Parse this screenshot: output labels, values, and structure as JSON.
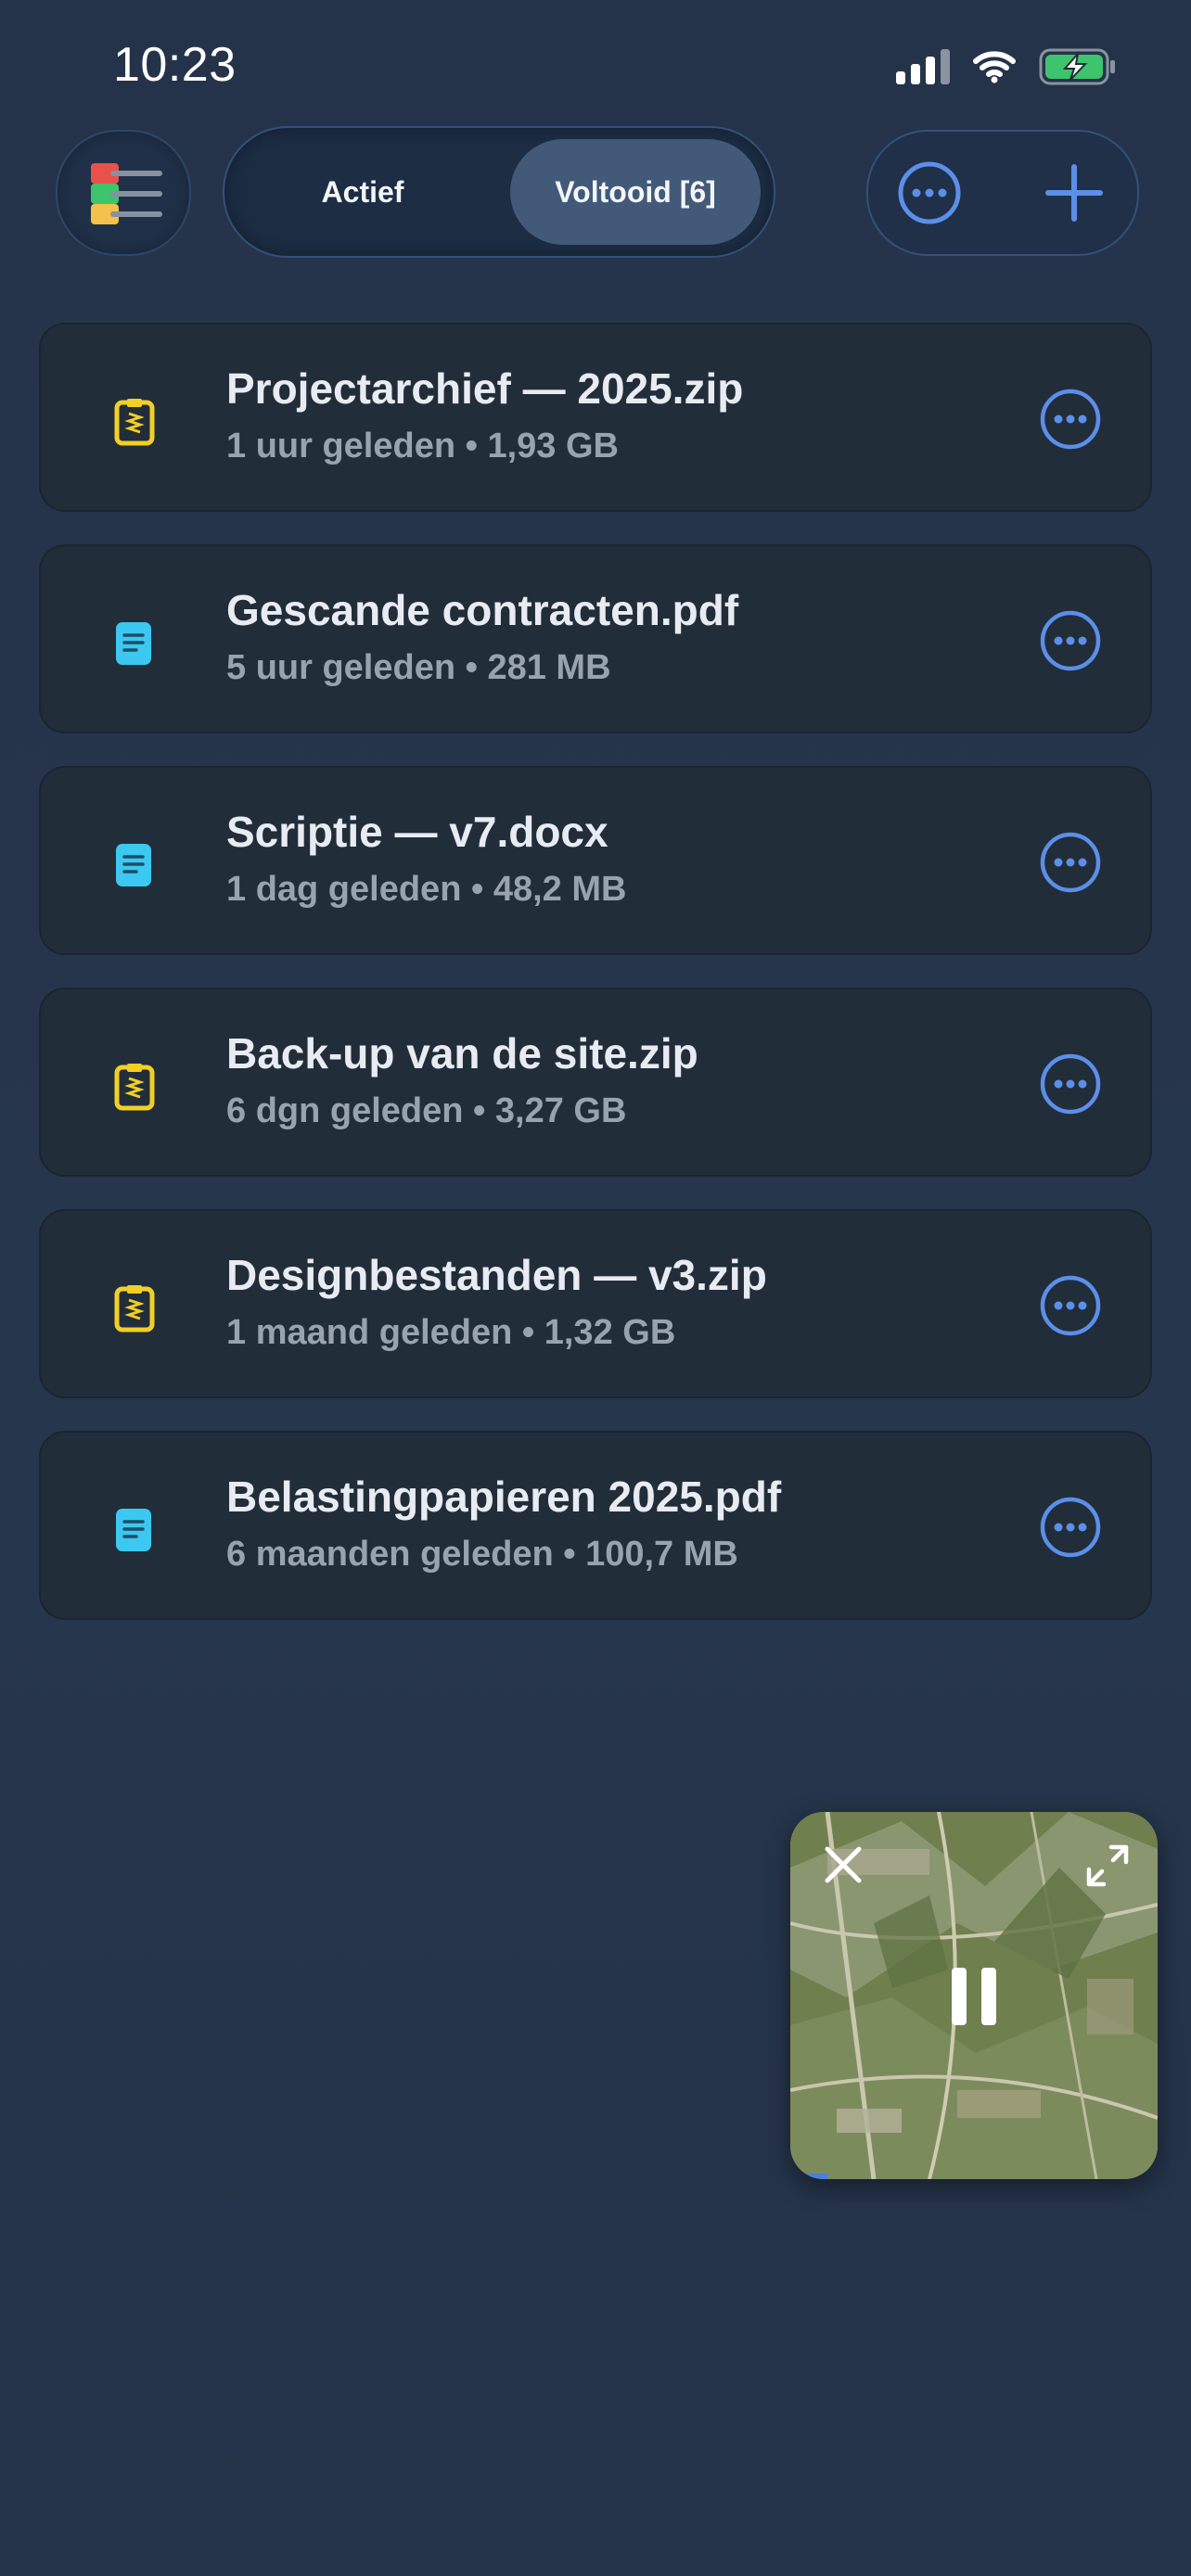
{
  "status": {
    "time": "10:23"
  },
  "segmented": {
    "active_label": "Actief",
    "done_label": "Voltooid [6]",
    "selected": "done"
  },
  "files": [
    {
      "name": "Projectarchief — 2025.zip",
      "meta": "1 uur geleden • 1,93 GB",
      "icon": "zip-icon"
    },
    {
      "name": "Gescande contracten.pdf",
      "meta": "5 uur geleden • 281 MB",
      "icon": "document-icon"
    },
    {
      "name": "Scriptie — v7.docx",
      "meta": "1 dag geleden • 48,2 MB",
      "icon": "document-icon"
    },
    {
      "name": "Back-up van de site.zip",
      "meta": "6 dgn geleden • 3,27 GB",
      "icon": "zip-icon"
    },
    {
      "name": "Designbestanden — v3.zip",
      "meta": "1 maand geleden • 1,32 GB",
      "icon": "zip-icon"
    },
    {
      "name": "Belastingpapieren 2025.pdf",
      "meta": "6 maanden geleden • 100,7 MB",
      "icon": "document-icon"
    }
  ],
  "player": {
    "state": "playing",
    "progress": 0.1
  },
  "colors": {
    "accent": "#5b8fe8",
    "zip": "#f2cf25",
    "document": "#3cc8f0",
    "background": "#26354b"
  }
}
